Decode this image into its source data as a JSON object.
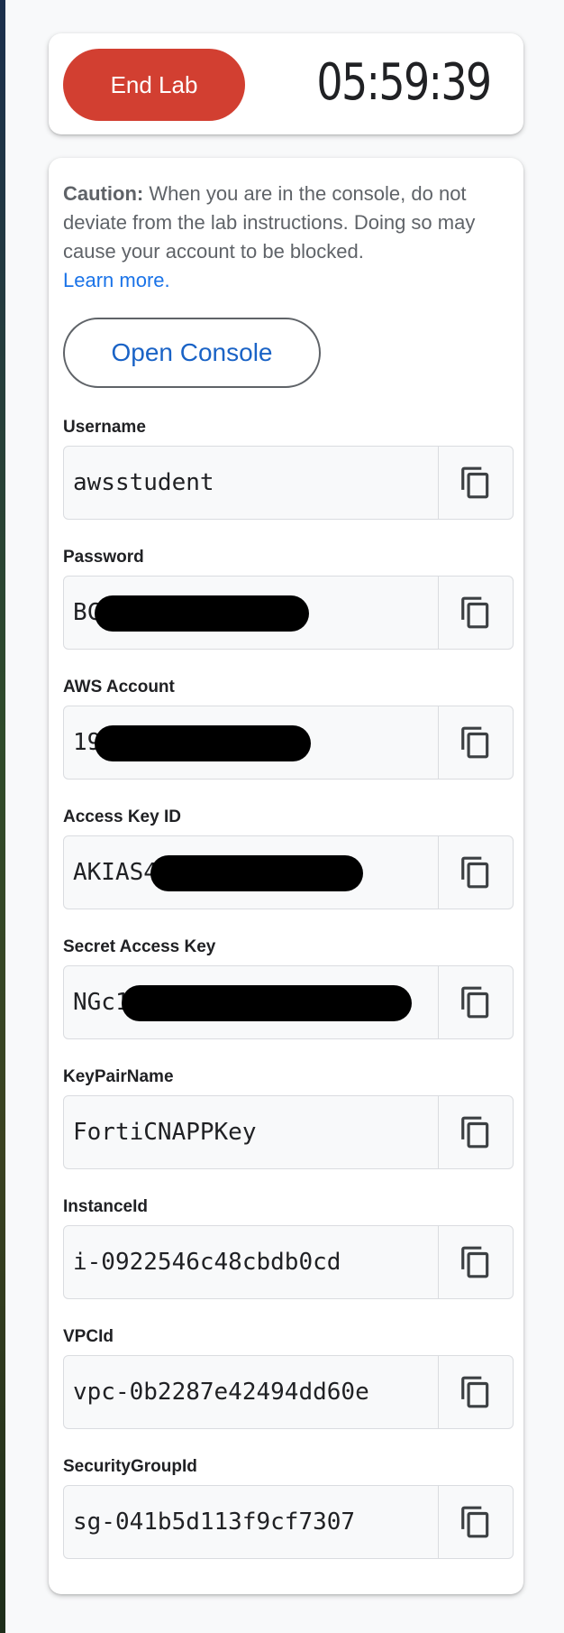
{
  "header": {
    "end_lab_label": "End Lab",
    "timer": "05:59:39"
  },
  "caution": {
    "bold": "Caution:",
    "text": " When you are in the console, do not deviate from the lab instructions. Doing so may cause your account to be blocked.",
    "learn_more": "Learn more."
  },
  "open_console_label": "Open Console",
  "fields": [
    {
      "label": "Username",
      "value": "awsstudent"
    },
    {
      "label": "Password",
      "value": "BC"
    },
    {
      "label": "AWS Account",
      "value": "19"
    },
    {
      "label": "Access Key ID",
      "value": "AKIAS4"
    },
    {
      "label": "Secret Access Key",
      "value": "NGc1"
    },
    {
      "label": "KeyPairName",
      "value": "FortiCNAPPKey"
    },
    {
      "label": "InstanceId",
      "value": "i-0922546c48cbdb0cd"
    },
    {
      "label": "VPCId",
      "value": "vpc-0b2287e42494dd60e"
    },
    {
      "label": "SecurityGroupId",
      "value": "sg-041b5d113f9cf7307"
    }
  ],
  "colors": {
    "end_lab": "#d23f31",
    "link": "#1a73e8",
    "console_text": "#1a63c6"
  },
  "icons": {
    "copy": "copy-icon"
  }
}
